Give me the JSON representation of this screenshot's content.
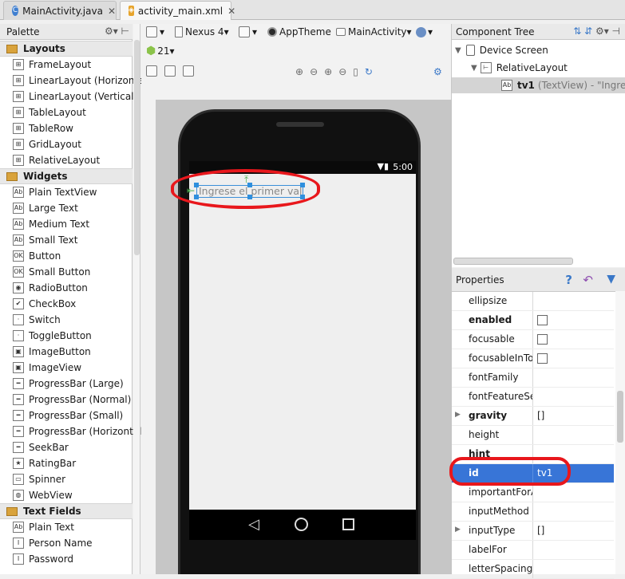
{
  "tabs": [
    {
      "label": "MainActivity.java",
      "icon": "java-class-icon"
    },
    {
      "label": "activity_main.xml",
      "icon": "xml-layout-icon"
    }
  ],
  "palette": {
    "title": "Palette",
    "categories": [
      {
        "label": "Layouts",
        "items": [
          "FrameLayout",
          "LinearLayout (Horizontal)",
          "LinearLayout (Vertical)",
          "TableLayout",
          "TableRow",
          "GridLayout",
          "RelativeLayout"
        ]
      },
      {
        "label": "Widgets",
        "items": [
          "Plain TextView",
          "Large Text",
          "Medium Text",
          "Small Text",
          "Button",
          "Small Button",
          "RadioButton",
          "CheckBox",
          "Switch",
          "ToggleButton",
          "ImageButton",
          "ImageView",
          "ProgressBar (Large)",
          "ProgressBar (Normal)",
          "ProgressBar (Small)",
          "ProgressBar (Horizontal)",
          "SeekBar",
          "RatingBar",
          "Spinner",
          "WebView"
        ]
      },
      {
        "label": "Text Fields",
        "items": [
          "Plain Text",
          "Person Name",
          "Password"
        ]
      }
    ]
  },
  "toolbar": {
    "device": "Nexus 4",
    "theme": "AppTheme",
    "activity": "MainActivity",
    "api_level": "21"
  },
  "device_screen": {
    "status_time": "5:00",
    "textview_text": "Ingrese el primer valor"
  },
  "component_tree": {
    "title": "Component Tree",
    "nodes": [
      {
        "label": "Device Screen"
      },
      {
        "label": "RelativeLayout"
      },
      {
        "label": "tv1",
        "detail": "(TextView) - \"Ingrese"
      }
    ]
  },
  "properties": {
    "title": "Properties",
    "rows": [
      {
        "name": "ellipsize",
        "value": "",
        "type": "text",
        "bold": false,
        "expandable": false
      },
      {
        "name": "enabled",
        "value": "",
        "type": "checkbox",
        "bold": true,
        "expandable": false
      },
      {
        "name": "focusable",
        "value": "",
        "type": "checkbox",
        "bold": false,
        "expandable": false
      },
      {
        "name": "focusableInTouchMode",
        "value": "",
        "type": "checkbox",
        "bold": false,
        "expandable": false
      },
      {
        "name": "fontFamily",
        "value": "",
        "type": "text",
        "bold": false,
        "expandable": false
      },
      {
        "name": "fontFeatureSettings",
        "value": "",
        "type": "text",
        "bold": false,
        "expandable": false
      },
      {
        "name": "gravity",
        "value": "[]",
        "type": "text",
        "bold": true,
        "expandable": true
      },
      {
        "name": "height",
        "value": "",
        "type": "text",
        "bold": false,
        "expandable": false
      },
      {
        "name": "hint",
        "value": "",
        "type": "text",
        "bold": true,
        "expandable": false
      },
      {
        "name": "id",
        "value": "tv1",
        "type": "text",
        "bold": true,
        "expandable": false,
        "selected": true
      },
      {
        "name": "importantForAccessibility",
        "value": "",
        "type": "text",
        "bold": false,
        "expandable": false
      },
      {
        "name": "inputMethod",
        "value": "",
        "type": "text",
        "bold": false,
        "expandable": false
      },
      {
        "name": "inputType",
        "value": "[]",
        "type": "text",
        "bold": false,
        "expandable": true
      },
      {
        "name": "labelFor",
        "value": "",
        "type": "text",
        "bold": false,
        "expandable": false
      },
      {
        "name": "letterSpacing",
        "value": "",
        "type": "text",
        "bold": false,
        "expandable": false
      }
    ]
  },
  "colors": {
    "highlight": "#e8171c",
    "selection": "#3875d7",
    "accent_blue": "#2f8fdd"
  }
}
